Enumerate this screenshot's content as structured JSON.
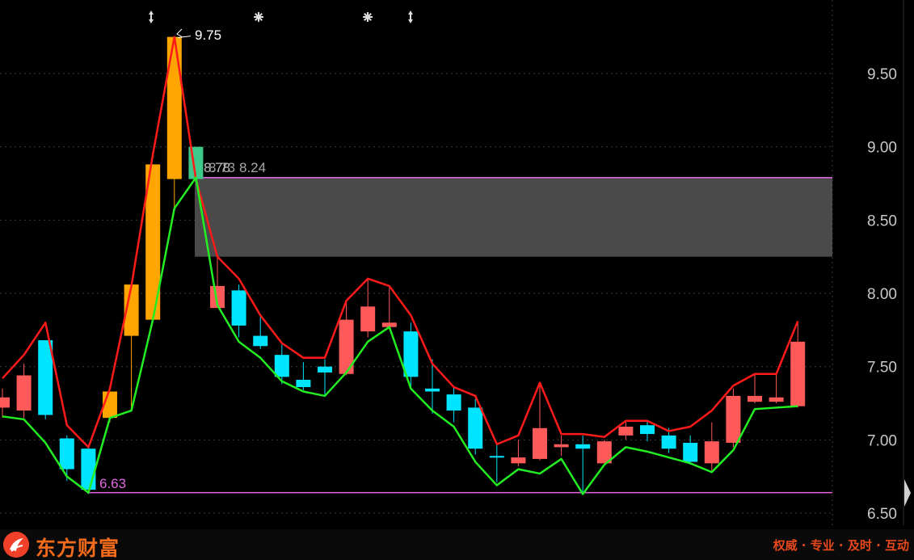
{
  "app": {
    "brand_name": "东方财富",
    "slogan": "权威 · 专业 · 及时 · 互动",
    "logo_icon": "eastmoney-logo-icon"
  },
  "colors": {
    "background": "#000000",
    "up_candle": "#ff5a5a",
    "down_candle": "#00e5ff",
    "highlight_candle": "#ffa500",
    "signal_candle": "#3cc98a",
    "upper_line": "#ff1a1a",
    "lower_line": "#22ee22",
    "support_line": "#e066e0",
    "zone_fill": "#4a4a4a",
    "axis_text": "#c8c8c8",
    "grid": "#3a3a3a"
  },
  "annotations": {
    "high_label": "9.75",
    "low_label": "6.63",
    "zone_label_a": "8.78",
    "zone_label_b": "8.73",
    "zone_label_c": "8.24",
    "marker_icons": [
      "updown-arrow-icon",
      "star-burst-icon",
      "star-burst-icon",
      "updown-arrow-icon"
    ]
  },
  "chart_data": {
    "type": "candlestick",
    "ylim": [
      6.45,
      9.95
    ],
    "y_ticks": [
      "9.50",
      "9.00",
      "8.50",
      "8.00",
      "7.50",
      "7.00",
      "6.50"
    ],
    "y_tick_values": [
      9.5,
      9.0,
      8.5,
      8.0,
      7.5,
      7.0,
      6.5
    ],
    "support_level": 6.64,
    "resistance_level": 8.79,
    "zone_low": 8.25,
    "candles": [
      {
        "o": 7.22,
        "c": 7.29,
        "h": 7.35,
        "l": 7.15,
        "kind": "up"
      },
      {
        "o": 7.2,
        "c": 7.44,
        "h": 7.52,
        "l": 7.15,
        "kind": "up"
      },
      {
        "o": 7.68,
        "c": 7.17,
        "h": 7.68,
        "l": 7.14,
        "kind": "down"
      },
      {
        "o": 7.01,
        "c": 6.8,
        "h": 7.03,
        "l": 6.72,
        "kind": "down"
      },
      {
        "o": 6.94,
        "c": 6.66,
        "h": 6.96,
        "l": 6.63,
        "kind": "down"
      },
      {
        "o": 7.15,
        "c": 7.33,
        "h": 7.33,
        "l": 7.12,
        "kind": "hi"
      },
      {
        "o": 7.71,
        "c": 8.06,
        "h": 8.06,
        "l": 7.2,
        "kind": "hi"
      },
      {
        "o": 7.82,
        "c": 8.88,
        "h": 8.88,
        "l": 7.82,
        "kind": "hi"
      },
      {
        "o": 8.78,
        "c": 9.75,
        "h": 9.75,
        "l": 8.58,
        "kind": "hi"
      },
      {
        "o": 9.0,
        "c": 8.78,
        "h": 9.0,
        "l": 8.78,
        "kind": "sig"
      },
      {
        "o": 7.9,
        "c": 8.05,
        "h": 8.25,
        "l": 7.9,
        "kind": "up"
      },
      {
        "o": 8.02,
        "c": 7.78,
        "h": 8.06,
        "l": 7.7,
        "kind": "down"
      },
      {
        "o": 7.71,
        "c": 7.64,
        "h": 7.85,
        "l": 7.62,
        "kind": "down"
      },
      {
        "o": 7.58,
        "c": 7.43,
        "h": 7.65,
        "l": 7.38,
        "kind": "down"
      },
      {
        "o": 7.41,
        "c": 7.36,
        "h": 7.53,
        "l": 7.34,
        "kind": "down"
      },
      {
        "o": 7.5,
        "c": 7.46,
        "h": 7.55,
        "l": 7.3,
        "kind": "down"
      },
      {
        "o": 7.45,
        "c": 7.82,
        "h": 7.95,
        "l": 7.44,
        "kind": "up"
      },
      {
        "o": 7.74,
        "c": 7.91,
        "h": 8.1,
        "l": 7.7,
        "kind": "up"
      },
      {
        "o": 7.77,
        "c": 7.8,
        "h": 8.05,
        "l": 7.75,
        "kind": "up"
      },
      {
        "o": 7.74,
        "c": 7.43,
        "h": 7.8,
        "l": 7.36,
        "kind": "down"
      },
      {
        "o": 7.35,
        "c": 7.33,
        "h": 7.55,
        "l": 7.18,
        "kind": "down"
      },
      {
        "o": 7.31,
        "c": 7.2,
        "h": 7.36,
        "l": 7.12,
        "kind": "down"
      },
      {
        "o": 7.22,
        "c": 6.94,
        "h": 7.28,
        "l": 6.9,
        "kind": "down"
      },
      {
        "o": 6.89,
        "c": 6.88,
        "h": 6.97,
        "l": 6.71,
        "kind": "down"
      },
      {
        "o": 6.84,
        "c": 6.88,
        "h": 7.0,
        "l": 6.82,
        "kind": "up"
      },
      {
        "o": 6.87,
        "c": 7.08,
        "h": 7.38,
        "l": 6.86,
        "kind": "up"
      },
      {
        "o": 6.95,
        "c": 6.97,
        "h": 7.03,
        "l": 6.89,
        "kind": "up"
      },
      {
        "o": 6.97,
        "c": 6.94,
        "h": 7.03,
        "l": 6.63,
        "kind": "down"
      },
      {
        "o": 6.84,
        "c": 6.99,
        "h": 7.0,
        "l": 6.84,
        "kind": "up"
      },
      {
        "o": 7.03,
        "c": 7.09,
        "h": 7.13,
        "l": 7.0,
        "kind": "up"
      },
      {
        "o": 7.1,
        "c": 7.04,
        "h": 7.13,
        "l": 6.99,
        "kind": "down"
      },
      {
        "o": 7.03,
        "c": 6.94,
        "h": 7.08,
        "l": 6.91,
        "kind": "down"
      },
      {
        "o": 6.98,
        "c": 6.85,
        "h": 7.03,
        "l": 6.83,
        "kind": "down"
      },
      {
        "o": 6.84,
        "c": 6.99,
        "h": 7.12,
        "l": 6.79,
        "kind": "up"
      },
      {
        "o": 6.98,
        "c": 7.3,
        "h": 7.35,
        "l": 6.95,
        "kind": "up"
      },
      {
        "o": 7.26,
        "c": 7.3,
        "h": 7.45,
        "l": 7.25,
        "kind": "up"
      },
      {
        "o": 7.26,
        "c": 7.29,
        "h": 7.45,
        "l": 7.25,
        "kind": "up"
      },
      {
        "o": 7.23,
        "c": 7.67,
        "h": 7.8,
        "l": 7.22,
        "kind": "up"
      }
    ],
    "upper_line": [
      7.42,
      7.58,
      7.8,
      7.1,
      6.95,
      7.35,
      8.05,
      8.95,
      9.75,
      8.78,
      8.25,
      8.1,
      7.85,
      7.66,
      7.56,
      7.56,
      7.95,
      8.1,
      8.05,
      7.85,
      7.52,
      7.36,
      7.3,
      6.97,
      7.03,
      7.39,
      7.04,
      7.04,
      7.02,
      7.13,
      7.13,
      7.06,
      7.09,
      7.2,
      7.37,
      7.45,
      7.45,
      7.81
    ],
    "lower_line": [
      7.16,
      7.14,
      6.98,
      6.75,
      6.64,
      7.15,
      7.2,
      7.82,
      8.58,
      8.79,
      7.92,
      7.67,
      7.56,
      7.4,
      7.33,
      7.3,
      7.46,
      7.67,
      7.77,
      7.35,
      7.2,
      7.09,
      6.85,
      6.69,
      6.8,
      6.77,
      6.87,
      6.63,
      6.83,
      6.95,
      6.92,
      6.88,
      6.84,
      6.78,
      6.93,
      7.21,
      7.22,
      7.23
    ]
  }
}
